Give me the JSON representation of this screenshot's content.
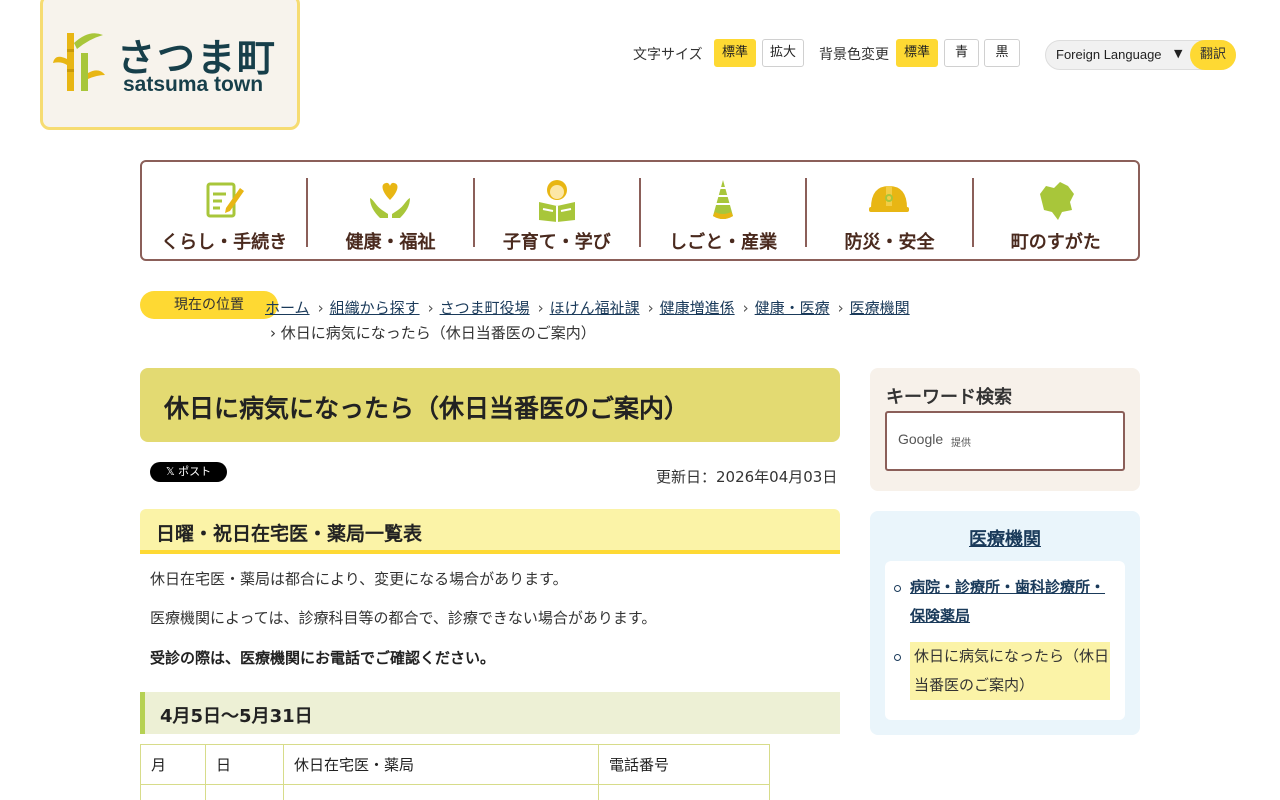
{
  "logo": {
    "jp": "さつま町",
    "en": "satsuma town"
  },
  "header": {
    "font_size_label": "文字サイズ",
    "font_size_options": [
      "標準",
      "拡大"
    ],
    "bg_label": "背景色変更",
    "bg_options": [
      "標準",
      "青",
      "黒"
    ],
    "language": {
      "label": "Foreign Language",
      "caret": "▼",
      "button": "翻訳"
    }
  },
  "gnav": [
    {
      "label": "くらし・手続き",
      "icon": "document-pen-icon"
    },
    {
      "label": "健康・福祉",
      "icon": "heart-hands-icon"
    },
    {
      "label": "子育て・学び",
      "icon": "child-reading-icon"
    },
    {
      "label": "しごと・産業",
      "icon": "bamboo-shoot-icon"
    },
    {
      "label": "防災・安全",
      "icon": "helmet-icon"
    },
    {
      "label": "町のすがた",
      "icon": "town-map-icon"
    }
  ],
  "breadcrumb": {
    "badge": "現在の位置",
    "sep": "›",
    "links": [
      "ホーム",
      "組織から探す",
      "さつま町役場",
      "ほけん福祉課",
      "健康増進係",
      "健康・医療",
      "医療機関"
    ],
    "current": "休日に病気になったら（休日当番医のご案内）"
  },
  "page": {
    "title": "休日に病気になったら（休日当番医のご案内）",
    "x_post": "𝕏 ポスト",
    "updated": "更新日：2026年04月03日",
    "h2": "日曜・祝日在宅医・薬局一覧表",
    "paragraphs": [
      "休日在宅医・薬局は都合により、変更になる場合があります。",
      "医療機関によっては、診療科目等の都合で、診療できない場合があります。",
      "受診の際は、医療機関にお電話でご確認ください。"
    ],
    "h3": "4月5日～5月31日",
    "table": {
      "headers": [
        "月",
        "日",
        "休日在宅医・薬局",
        "電話番号"
      ]
    }
  },
  "sidebar": {
    "keyword_title": "キーワード検索",
    "google_label": "Google",
    "google_suffix": "提供",
    "nav_title": "医療機関",
    "nav_items": [
      "病院・診療所・歯科診療所・保険薬局",
      "休日に病気になったら（休日当番医のご案内）"
    ]
  },
  "colors": {
    "accent_yellow": "#fed933",
    "nav_border": "#8b5f59",
    "link": "#1a3a5a",
    "title_bg": "#e3da72"
  }
}
